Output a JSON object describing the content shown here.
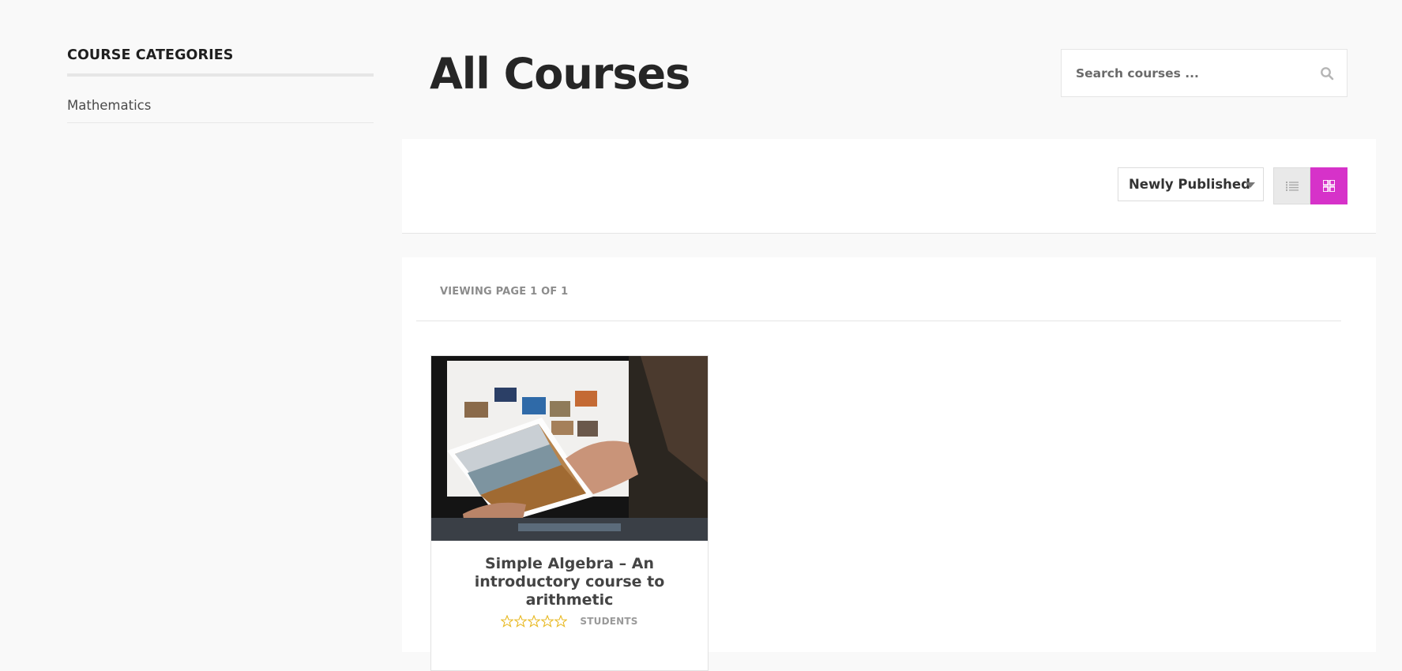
{
  "sidebar": {
    "title": "COURSE CATEGORIES",
    "items": [
      {
        "label": "Mathematics"
      }
    ]
  },
  "header": {
    "title": "All Courses",
    "search": {
      "placeholder": "Search courses ...",
      "value": "",
      "icon": "search-icon"
    }
  },
  "toolbar": {
    "sort": {
      "selected": "Newly Published"
    },
    "view_modes": [
      {
        "name": "list",
        "icon": "list-icon",
        "active": false
      },
      {
        "name": "grid",
        "icon": "grid-icon",
        "active": true
      }
    ]
  },
  "results": {
    "viewing_text": "VIEWING PAGE 1 OF 1",
    "courses": [
      {
        "title": "Simple Algebra – An introductory course to arithmetic",
        "rating": 0,
        "rating_max": 5,
        "students_label": "STUDENTS",
        "thumbnail": "person-holding-photo-in-front-of-monitor"
      }
    ]
  },
  "colors": {
    "accent": "#d632c9",
    "star": "#e8b923",
    "background": "#f9f9f9",
    "panel": "#ffffff",
    "text_dark": "#262626",
    "text_muted": "#8c8c8c"
  }
}
